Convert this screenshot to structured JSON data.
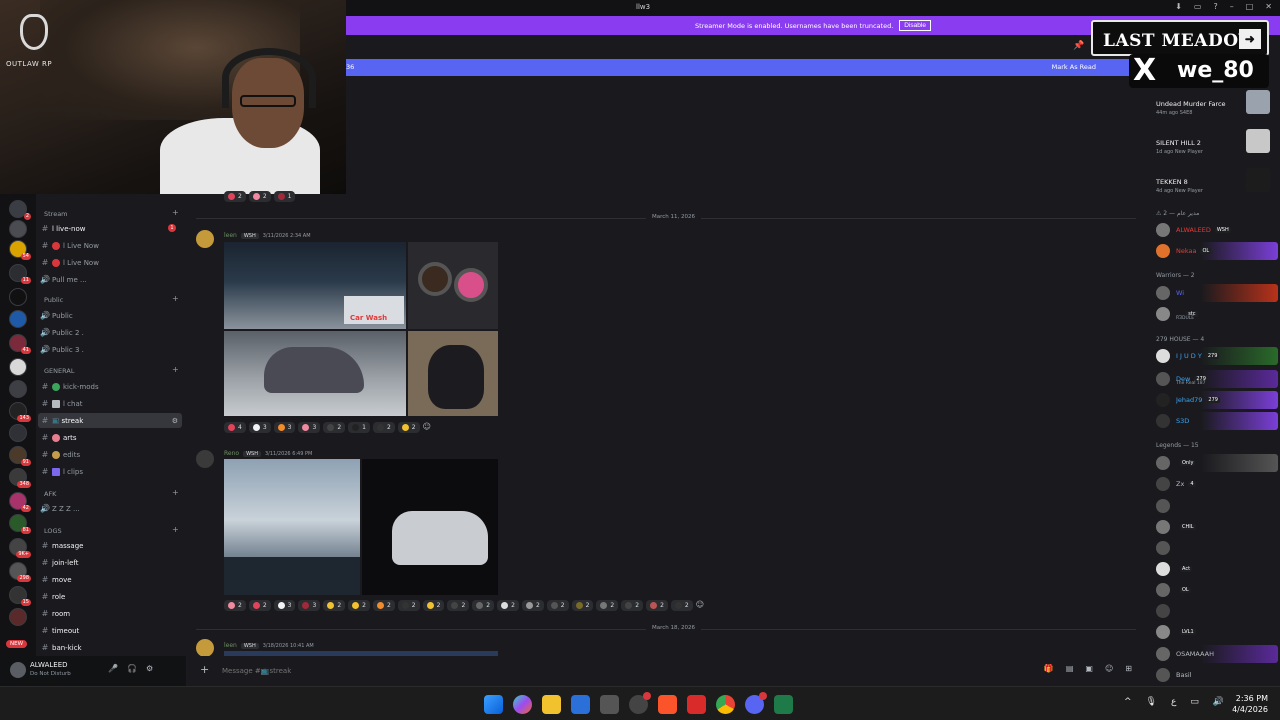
{
  "window": {
    "title": "llw3"
  },
  "streamer_banner": {
    "text": "Streamer Mode is enabled. Usernames have been truncated.",
    "button": "Disable"
  },
  "new_messages_bar": {
    "left_text": "36",
    "right_text": "Mark As Read"
  },
  "webcam_logo": {
    "text": "OUTLAW RP"
  },
  "server_rail": {
    "badges": [
      "2",
      "54",
      "11",
      "41",
      "143",
      "91",
      "348",
      "42",
      "81",
      "9K+",
      "298",
      "15"
    ],
    "new_label": "NEW"
  },
  "channels": {
    "categories": {
      "stream": "Stream",
      "public": "Public",
      "general": "GENERAL",
      "afk": "AFK",
      "logs": "LOGS"
    },
    "stream": [
      {
        "label": "l live-now",
        "unread": "1"
      },
      {
        "label": "l Live Now"
      },
      {
        "label": "l Live Now"
      },
      {
        "label": "Pull me ..."
      }
    ],
    "public": [
      {
        "label": "Public"
      },
      {
        "label": "Public 2 ."
      },
      {
        "label": "Public 3 ."
      }
    ],
    "general": [
      {
        "label": "kick-mods"
      },
      {
        "label": "l chat"
      },
      {
        "label": "streak"
      },
      {
        "label": "arts"
      },
      {
        "label": "edits"
      },
      {
        "label": "l clips"
      }
    ],
    "afk": [
      {
        "label": "Z Z Z ..."
      }
    ],
    "logs": [
      {
        "label": "massage"
      },
      {
        "label": "join-left"
      },
      {
        "label": "move"
      },
      {
        "label": "role"
      },
      {
        "label": "room"
      },
      {
        "label": "timeout"
      },
      {
        "label": "ban-kick"
      }
    ]
  },
  "user_panel": {
    "name": "ALWALEED",
    "status": "Do Not Disturb"
  },
  "chat": {
    "top_reactions": [
      "2",
      "2",
      "1"
    ],
    "dates": [
      "March 11, 2026",
      "March 18, 2026"
    ],
    "messages": [
      {
        "user": "leen",
        "tag": "WSH",
        "time": "3/11/2026 2:34 AM",
        "image_caption": "Car Wash",
        "reactions": [
          "4",
          "3",
          "3",
          "3",
          "2",
          "1",
          "2",
          "2"
        ]
      },
      {
        "user": "Reno",
        "tag": "WSH",
        "time": "3/11/2026 6:49 PM",
        "reactions": [
          "2",
          "2",
          "3",
          "3",
          "2",
          "2",
          "2",
          "2",
          "2",
          "2",
          "2",
          "2",
          "2",
          "2",
          "2",
          "2",
          "2",
          "2",
          "2"
        ]
      },
      {
        "user": "leen",
        "tag": "WSH",
        "time": "3/18/2026 10:41 AM"
      }
    ]
  },
  "composer": {
    "placeholder": "Message #📺streak"
  },
  "members": {
    "activities": [
      {
        "title": "Undead Murder Farce",
        "sub": "44m ago  S4E8"
      },
      {
        "title": "SILENT HILL 2",
        "sub": "1d ago  New Player"
      },
      {
        "title": "TEKKEN 8",
        "sub": "4d ago  New Player"
      }
    ],
    "groups": [
      {
        "name": "⚠ مدير عام — 2",
        "members": [
          {
            "name": "ALWALEED",
            "badge": "WSH",
            "color": "#e23b3b"
          },
          {
            "name": "Nekaa",
            "badge": "OL",
            "color": "#e23b3b"
          }
        ]
      },
      {
        "name": "Warriors — 2",
        "members": [
          {
            "name": "Wi",
            "badge": "",
            "color": "#5865f2"
          },
          {
            "name": "...",
            "badge": "stc",
            "sub": "R3DULE",
            "color": "#5865f2"
          }
        ]
      },
      {
        "name": "279 HOUSE — 4",
        "members": [
          {
            "name": "I J U D Y",
            "badge": "279",
            "color": "#3ba5f2"
          },
          {
            "name": "Dew",
            "badge": "279",
            "sub": "The Real 187",
            "color": "#3ba5f2"
          },
          {
            "name": "Jehad79",
            "badge": "279",
            "color": "#3ba5f2"
          },
          {
            "name": "S3D",
            "badge": "",
            "color": "#3ba5f2"
          }
        ]
      },
      {
        "name": "Legends — 15",
        "members": [
          {
            "name": "",
            "badge": "Only",
            "color": "#b5bac1"
          },
          {
            "name": "Zx",
            "badge": "4",
            "color": "#b5bac1"
          },
          {
            "name": "",
            "badge": "",
            "color": "#b5bac1"
          },
          {
            "name": "",
            "badge": "CHIL",
            "color": "#b5bac1"
          },
          {
            "name": "",
            "badge": "",
            "color": "#b5bac1"
          },
          {
            "name": "",
            "badge": "Act",
            "color": "#b5bac1"
          },
          {
            "name": "",
            "badge": "OL",
            "color": "#b5bac1"
          },
          {
            "name": "",
            "badge": "",
            "color": "#b5bac1"
          },
          {
            "name": "",
            "badge": "LVL1",
            "color": "#b5bac1"
          },
          {
            "name": "OSAMAAAH",
            "badge": "",
            "color": "#b5bac1"
          },
          {
            "name": "Basil",
            "badge": "",
            "color": "#b5bac1"
          }
        ]
      }
    ]
  },
  "overlay": {
    "title": "LAST MEADOW",
    "handle": "we_80"
  },
  "taskbar": {
    "time": "2:36 PM",
    "date": "4/4/2026",
    "lang": "ع"
  }
}
